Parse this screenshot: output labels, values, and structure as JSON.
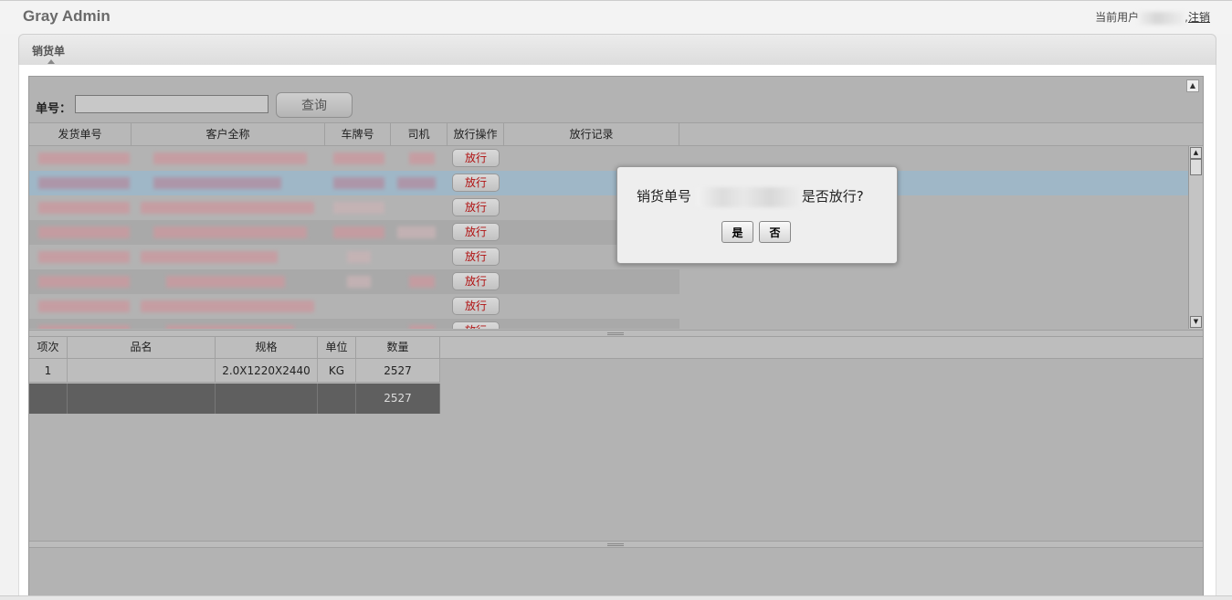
{
  "header": {
    "app_title": "Gray Admin",
    "user_label": "当前用户",
    "logout_separator": ",",
    "logout_label": "注销"
  },
  "tabs": [
    {
      "label": "销货单",
      "active": true
    }
  ],
  "search": {
    "label": "单号：",
    "value": "",
    "button_label": "查询"
  },
  "grid": {
    "columns": [
      "发货单号",
      "客户全称",
      "车牌号",
      "司机",
      "放行操作",
      "放行记录"
    ],
    "release_button_label": "放行",
    "rows": [
      {
        "release_label": "放行"
      },
      {
        "release_label": "放行",
        "selected": true
      },
      {
        "release_label": "放行"
      },
      {
        "release_label": "放行"
      },
      {
        "release_label": "放行"
      },
      {
        "release_label": "放行"
      },
      {
        "release_label": "放行"
      },
      {
        "release_label": "放行"
      }
    ]
  },
  "detail_grid": {
    "columns": [
      "项次",
      "品名",
      "规格",
      "单位",
      "数量"
    ],
    "rows": [
      {
        "no": "1",
        "name": "",
        "spec": "2.0X1220X2440",
        "unit": "KG",
        "qty": "2527"
      }
    ],
    "summary": {
      "qty": "2527"
    }
  },
  "dialog": {
    "message_prefix": "销货单号",
    "message_suffix": "是否放行?",
    "yes_label": "是",
    "no_label": "否"
  },
  "colors": {
    "release_text": "#b01010",
    "selected_row": "#9fb7c7",
    "summary_row": "#5f5f5f"
  }
}
